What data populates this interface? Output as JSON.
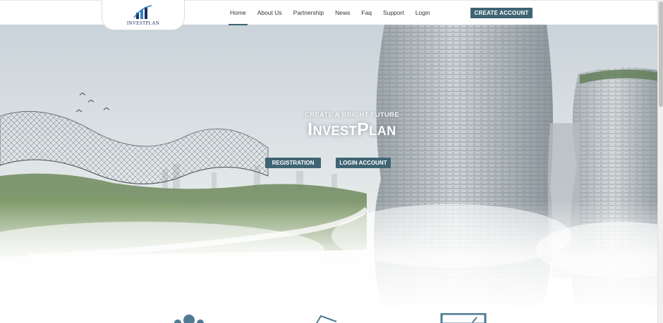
{
  "brand": {
    "name": "INVESTPLAN"
  },
  "nav": {
    "items": [
      {
        "label": "Home",
        "active": true
      },
      {
        "label": "About Us",
        "active": false
      },
      {
        "label": "Partnership",
        "active": false
      },
      {
        "label": "News",
        "active": false
      },
      {
        "label": "Faq",
        "active": false
      },
      {
        "label": "Support",
        "active": false
      },
      {
        "label": "Login",
        "active": false
      }
    ],
    "cta_label": "CREATE ACCOUNT"
  },
  "hero": {
    "tagline": "CREATE A BRIGHT FUTURE",
    "title": "InvestPlan",
    "registration_label": "REGISTRATION",
    "login_label": "LOGIN ACCOUNT"
  },
  "features": {
    "icons": [
      "people-icon",
      "card-icon",
      "monitor-icon"
    ]
  },
  "colors": {
    "accent": "#3f6474",
    "nav_text": "#333333",
    "logo_navy": "#1f2f5a",
    "logo_blue": "#2e7fc4"
  }
}
